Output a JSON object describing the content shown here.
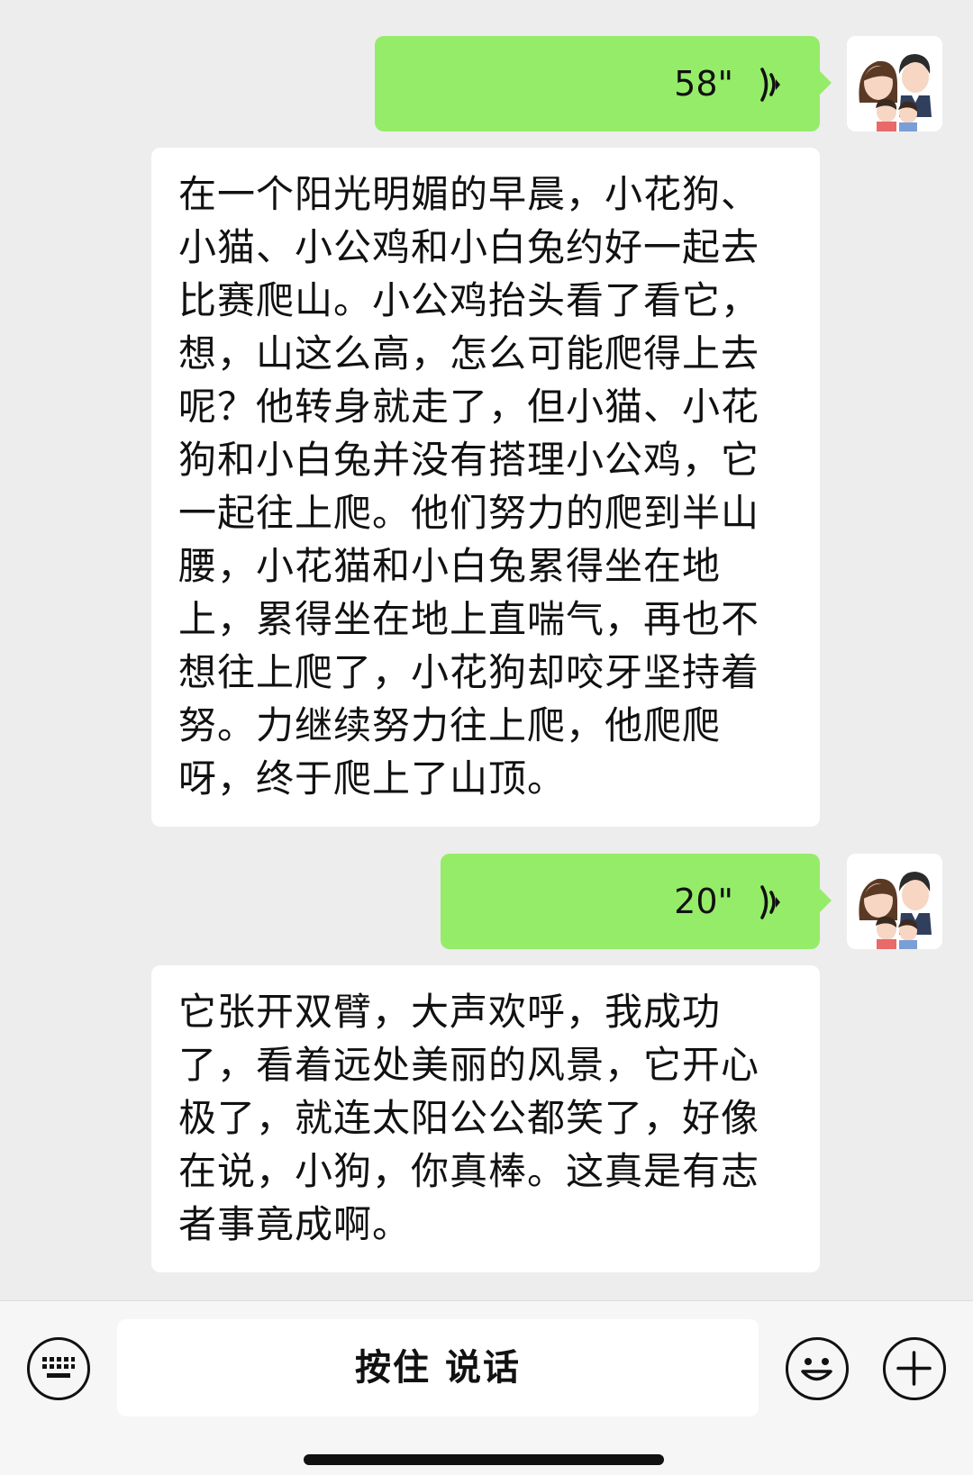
{
  "messages": [
    {
      "type": "voice",
      "duration": "58\""
    },
    {
      "type": "text",
      "text": "在一个阳光明媚的早晨，小花狗、小猫、小公鸡和小白兔约好一起去比赛爬山。小公鸡抬头看了看它，想，山这么高，怎么可能爬得上去呢？他转身就走了，但小猫、小花狗和小白兔并没有搭理小公鸡，它一起往上爬。他们努力的爬到半山腰，小花猫和小白兔累得坐在地上，累得坐在地上直喘气，再也不想往上爬了，小花狗却咬牙坚持着努。力继续努力往上爬，他爬爬呀，终于爬上了山顶。"
    },
    {
      "type": "voice",
      "duration": "20\""
    },
    {
      "type": "text",
      "text": "它张开双臂，大声欢呼，我成功了，看着远处美丽的风景，它开心极了，就连太阳公公都笑了，好像在说，小狗，你真棒。这真是有志者事竟成啊。"
    }
  ],
  "input_bar": {
    "hold_to_talk_label": "按住 说话",
    "keyboard_icon": "keyboard-icon",
    "emoji_icon": "emoji-icon",
    "plus_icon": "plus-icon"
  },
  "colors": {
    "background": "#ededed",
    "sent_bubble": "#95ec69",
    "received_card": "#ffffff"
  }
}
